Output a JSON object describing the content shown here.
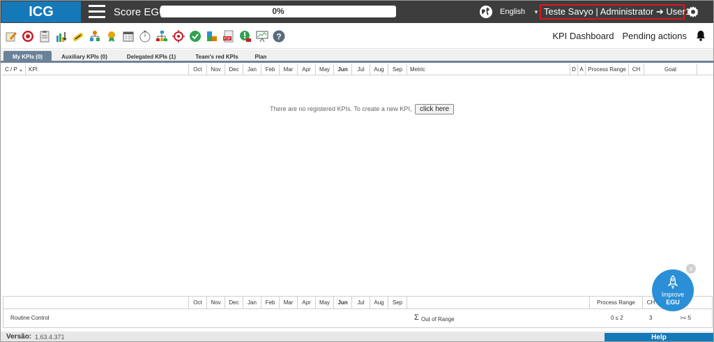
{
  "header": {
    "logo": "ICG",
    "score_label": "Score EGU:",
    "score_value": "0%",
    "language": "English",
    "user": "Teste Savyo  |  Administrator ➔ User1"
  },
  "toolbar": {
    "icons": [
      "edit-icon",
      "target-icon",
      "clipboard-icon",
      "chart-down-icon",
      "link-icon",
      "org-chart-icon",
      "award-icon",
      "calendar-icon",
      "stopwatch-icon",
      "hierarchy-icon",
      "crosshair-icon",
      "check-icon",
      "puzzle-icon",
      "pdf-icon",
      "warning-pin-icon",
      "presentation-icon",
      "help-icon"
    ],
    "kpi_dashboard": "KPI Dashboard",
    "pending_actions": "Pending actions"
  },
  "tabs": [
    {
      "label": "My KPIs (0)",
      "active": true
    },
    {
      "label": "Auxiliary KPIs (0)",
      "active": false
    },
    {
      "label": "Delegated KPIs (1)",
      "active": false
    },
    {
      "label": "Team's red KPIs",
      "active": false
    },
    {
      "label": "Plan",
      "active": false
    }
  ],
  "table": {
    "columns": [
      "C / P",
      "KPI",
      "Oct",
      "Nov",
      "Dec",
      "Jan",
      "Feb",
      "Mar",
      "Apr",
      "May",
      "Jun",
      "Jul",
      "Aug",
      "Sep",
      "Metric",
      "D",
      "A",
      "Process Range",
      "CH",
      "Goal"
    ],
    "empty_message": "There are no registered KPIs. To create a new KPI,",
    "click_here": "click here"
  },
  "footer_table": {
    "months": [
      "Oct",
      "Nov",
      "Dec",
      "Jan",
      "Feb",
      "Mar",
      "Apr",
      "May",
      "Jun",
      "Jul",
      "Aug",
      "Sep"
    ],
    "process_range_header": "Process Range",
    "ch_header": "CH",
    "row_label": "Routine Control",
    "sigma": "Σ",
    "out_of_range": "Out of Range",
    "process_range_value": "0 ≤ 2",
    "ch_value": "3",
    "goal_value": ">= 5"
  },
  "status": {
    "version_label": "Versão:",
    "version_value": "1.63.4.371",
    "help": "Help"
  },
  "improve": {
    "line1": "Improve",
    "line2": "EGU",
    "close": "x"
  },
  "colors": {
    "topbar": "#3d3d3d",
    "brand_blue": "#1579b9",
    "tab_active": "#6b8199",
    "highlight_red": "#d71a1a"
  }
}
